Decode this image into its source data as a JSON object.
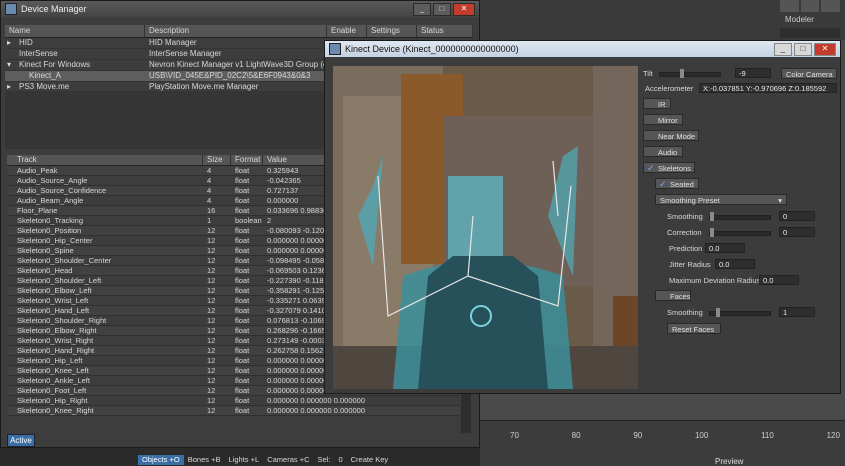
{
  "lightwave": {
    "modeler_label": "Modeler",
    "timeline_ticks": [
      "70",
      "80",
      "90",
      "100",
      "110",
      "120"
    ],
    "preview_label": "Preview",
    "create_key_label": "Create Key"
  },
  "device_manager": {
    "title": "Device Manager",
    "columns": [
      "Name",
      "Description",
      "Enable",
      "Settings",
      "Status"
    ],
    "devices": [
      {
        "name": "HID",
        "description": "HID Manager",
        "selected": false,
        "expander": "▸"
      },
      {
        "name": "InterSense",
        "description": "InterSense Manager",
        "selected": false,
        "expander": ""
      },
      {
        "name": "Kinect For Windows",
        "description": "Nevron Kinect Manager v1 LightWave3D Group (c) ..",
        "selected": false,
        "expander": "▾"
      },
      {
        "name": "Kinect_A",
        "description": "USB\\VID_045E&PID_02C2\\5&E6F0943&0&3",
        "selected": true,
        "expander": ""
      },
      {
        "name": "PS3 Move.me",
        "description": "PlayStation Move.me Manager",
        "selected": false,
        "expander": "▸"
      }
    ],
    "track_columns": [
      "Track",
      "Size",
      "Format",
      "Value"
    ],
    "tracks": [
      [
        "Audio_Peak",
        "4",
        "float",
        "0.325943"
      ],
      [
        "Audio_Source_Angle",
        "4",
        "float",
        "-0.042365"
      ],
      [
        "Audio_Source_Confidence",
        "4",
        "float",
        "0.727137"
      ],
      [
        "Audio_Beam_Angle",
        "4",
        "float",
        "0.000000"
      ],
      [
        "Floor_Plane",
        "16",
        "float",
        "0.033696 0.98836"
      ],
      [
        "Skeleton0_Tracking",
        "1",
        "boolean",
        "2"
      ],
      [
        "Skeleton0_Position",
        "12",
        "float",
        "-0.080093 -0.1204"
      ],
      [
        "Skeleton0_Hip_Center",
        "12",
        "float",
        "0.000000 0.00000"
      ],
      [
        "Skeleton0_Spine",
        "12",
        "float",
        "0.000000 0.00000"
      ],
      [
        "Skeleton0_Shoulder_Center",
        "12",
        "float",
        "-0.098495 -0.058"
      ],
      [
        "Skeleton0_Head",
        "12",
        "float",
        "-0.069503 0.1236"
      ],
      [
        "Skeleton0_Shoulder_Left",
        "12",
        "float",
        "-0.227390 -0.1185"
      ],
      [
        "Skeleton0_Elbow_Left",
        "12",
        "float",
        "-0.358291 -0.1251"
      ],
      [
        "Skeleton0_Wrist_Left",
        "12",
        "float",
        "-0.335271 0.0639"
      ],
      [
        "Skeleton0_Hand_Left",
        "12",
        "float",
        "-0.327079 0.1410"
      ],
      [
        "Skeleton0_Shoulder_Right",
        "12",
        "float",
        "0.076813 -0.1069"
      ],
      [
        "Skeleton0_Elbow_Right",
        "12",
        "float",
        "0.268296 -0.1665"
      ],
      [
        "Skeleton0_Wrist_Right",
        "12",
        "float",
        "0.273149 -0.0003"
      ],
      [
        "Skeleton0_Hand_Right",
        "12",
        "float",
        "0.262758 0.1562"
      ],
      [
        "Skeleton0_Hip_Left",
        "12",
        "float",
        "0.000000 0.00000"
      ],
      [
        "Skeleton0_Knee_Left",
        "12",
        "float",
        "0.000000 0.00000"
      ],
      [
        "Skeleton0_Ankle_Left",
        "12",
        "float",
        "0.000000 0.00000"
      ],
      [
        "Skeleton0_Foot_Left",
        "12",
        "float",
        "0.000000 0.000000 0.000000"
      ],
      [
        "Skeleton0_Hip_Right",
        "12",
        "float",
        "0.000000 0.000000 0.000000"
      ],
      [
        "Skeleton0_Knee_Right",
        "12",
        "float",
        "0.000000 0.000000 0.000000"
      ]
    ],
    "active_label": "Active"
  },
  "statusbar": {
    "objects": "Objects",
    "objects_key": "+O",
    "bones": "Bones",
    "bones_key": "+B",
    "lights": "Lights",
    "lights_key": "+L",
    "cameras": "Cameras",
    "cameras_key": "+C",
    "sel_label": "Sel:",
    "sel_value": "0"
  },
  "kinect": {
    "title": "Kinect Device (Kinect_0000000000000000)",
    "tilt_label": "Tilt",
    "tilt_value": "-9",
    "color_camera_label": "Color Camera",
    "accelerometer_label": "Accelerometer",
    "accelerometer_value": "X:-0.037851  Y:-0.970696  Z:0.185592",
    "ir_label": "IR",
    "mirror_label": "Mirror",
    "near_mode_label": "Near Mode",
    "audio_label": "Audio",
    "skeletons_label": "Skeletons",
    "seated_label": "Seated",
    "smoothing_preset_label": "Smoothing Preset",
    "smoothing_label": "Smoothing",
    "smoothing_value": "0",
    "correction_label": "Correction",
    "correction_value": "0",
    "prediction_label": "Prediction",
    "prediction_value": "0.0",
    "jitter_label": "Jitter Radius",
    "jitter_value": "0.0",
    "max_dev_label": "Maximum Deviation Radius",
    "max_dev_value": "0.0",
    "faces_label": "Faces",
    "faces_smoothing_label": "Smoothing",
    "faces_smoothing_value": "1",
    "reset_faces_label": "Reset Faces"
  }
}
